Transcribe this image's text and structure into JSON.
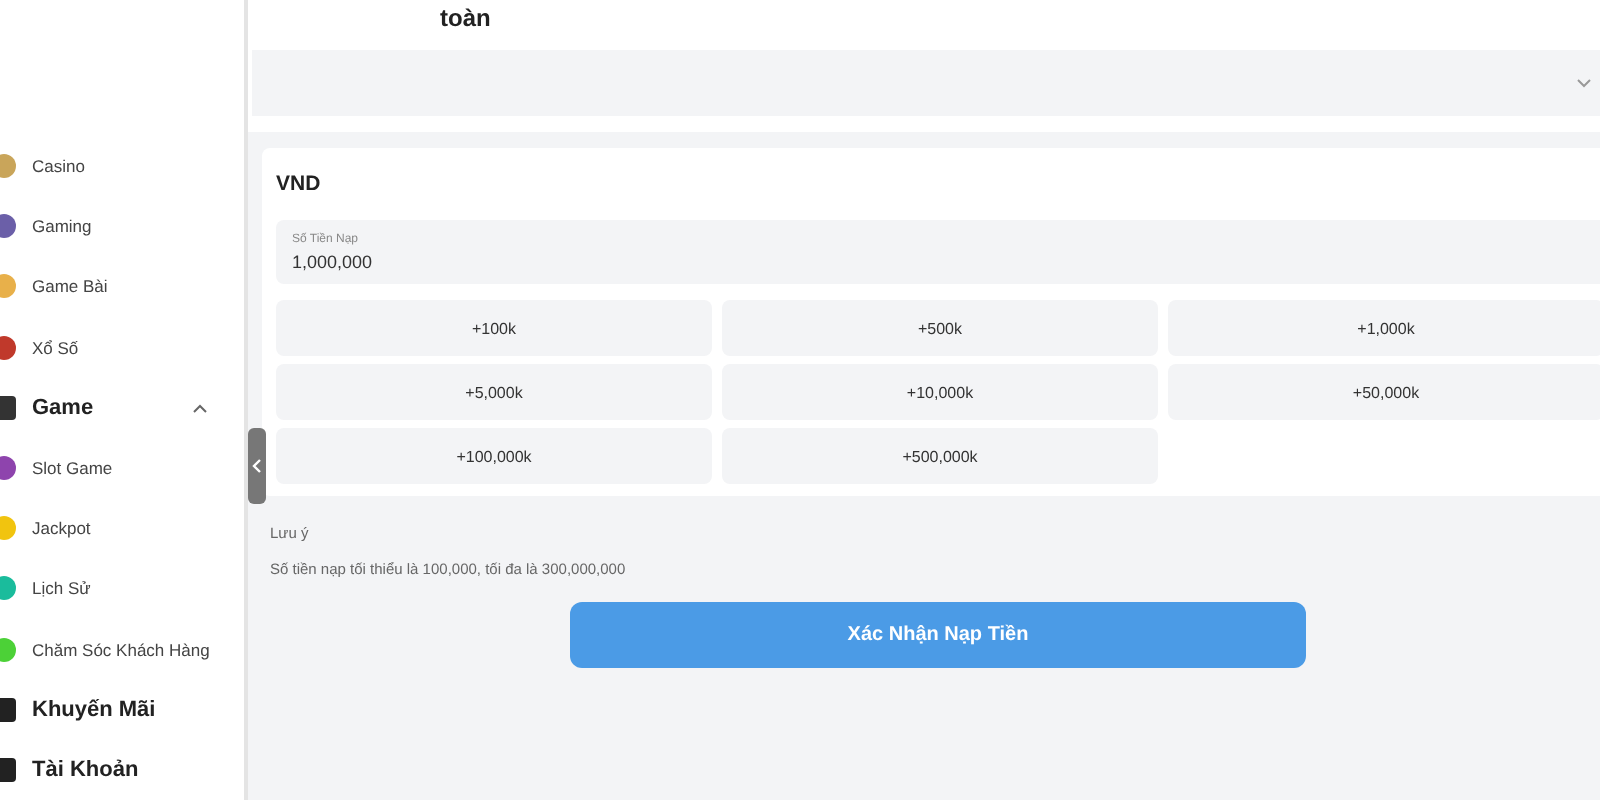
{
  "page_title": "toàn",
  "sidebar": {
    "items": [
      {
        "kind": "item",
        "label": "Casino",
        "color": "#c9a55a"
      },
      {
        "kind": "item",
        "label": "Gaming",
        "color": "#6b5fa8"
      },
      {
        "kind": "item",
        "label": "Game Bài",
        "color": "#e8b04a"
      },
      {
        "kind": "item",
        "label": "Xổ Số",
        "color": "#c0392b"
      },
      {
        "kind": "section",
        "label": "Game",
        "expanded": true,
        "color": "#333333"
      },
      {
        "kind": "item",
        "label": "Slot Game",
        "color": "#8e44ad"
      },
      {
        "kind": "item",
        "label": "Jackpot",
        "color": "#f1c40f"
      },
      {
        "kind": "item",
        "label": "Lịch Sử",
        "color": "#1abc9c"
      },
      {
        "kind": "item",
        "label": "Chăm Sóc Khách Hàng",
        "color": "#4cd137"
      },
      {
        "kind": "section",
        "label": "Khuyến Mãi",
        "color": "#222222"
      },
      {
        "kind": "section",
        "label": "Tài Khoản",
        "color": "#222222"
      }
    ]
  },
  "currency": "VND",
  "amount_field": {
    "label": "Số Tiền Nạp",
    "value": "1,000,000"
  },
  "amount_options": [
    "+100k",
    "+500k",
    "+1,000k",
    "+5,000k",
    "+10,000k",
    "+50,000k",
    "+100,000k",
    "+500,000k"
  ],
  "note_title": "Lưu ý",
  "note_text": "Số tiền nạp tối thiểu là 100,000, tối đa là 300,000,000",
  "confirm_button": "Xác Nhận Nạp Tiền"
}
